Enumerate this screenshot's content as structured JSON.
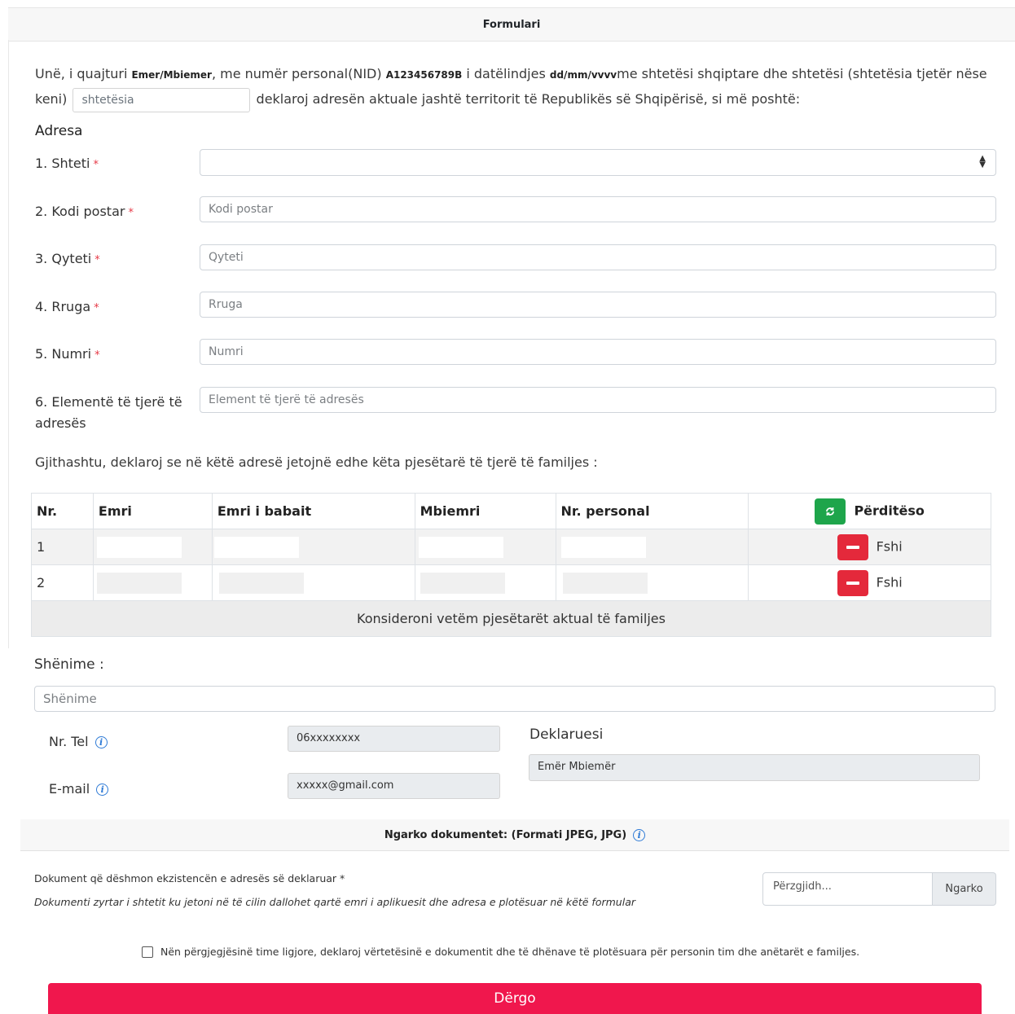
{
  "header": {
    "title": "Formulari"
  },
  "intro": {
    "p1": "Unë, i quajturi ",
    "name": "Emer/Mbiemer",
    "p2": ", me numër personal(NID) ",
    "nid": "A123456789B",
    "p3": " i datëlindjes ",
    "dob": "dd/mm/vvvv",
    "p4": "me shtetësi shqiptare dhe shtetësi (shtetësia tjetër nëse keni) ",
    "other_citizenship_placeholder": "shtetësia",
    "p5": " deklaroj adresën aktuale jashtë territorit të Republikës së Shqipërisë, si më poshtë:"
  },
  "address": {
    "title": "Adresa",
    "fields": [
      {
        "label": "1. Shteti",
        "required": "*",
        "placeholder": ""
      },
      {
        "label": "2. Kodi postar",
        "required": "*",
        "placeholder": "Kodi postar"
      },
      {
        "label": "3. Qyteti",
        "required": "*",
        "placeholder": "Qyteti"
      },
      {
        "label": "4. Rruga",
        "required": "*",
        "placeholder": "Rruga"
      },
      {
        "label": "5. Numri",
        "required": "*",
        "placeholder": "Numri"
      },
      {
        "label": "6. Elementë të tjerë të adresës",
        "required": "",
        "placeholder": "Element të tjerë të adresës"
      }
    ]
  },
  "family": {
    "intro": "Gjithashtu, deklaroj se në këtë adresë jetojnë edhe këta pjesëtarë të tjerë të familjes :",
    "columns": [
      "Nr.",
      "Emri",
      "Emri i babait",
      "Mbiemri",
      "Nr. personal"
    ],
    "update_label": "Përditëso",
    "rows": [
      {
        "nr": "1",
        "delete_label": "Fshi"
      },
      {
        "nr": "2",
        "delete_label": "Fshi"
      }
    ],
    "footer_note": "Konsideroni vetëm pjesëtarët aktual të familjes"
  },
  "notes": {
    "label": "Shënime :",
    "placeholder": "Shënime"
  },
  "contact": {
    "phone_label": "Nr. Tel",
    "phone_value": "06xxxxxxxx",
    "email_label": "E-mail",
    "email_value": "xxxxx@gmail.com",
    "declarant_label": "Deklaruesi",
    "declarant_value": "Emër Mbiemër"
  },
  "upload": {
    "title": "Ngarko dokumentet: (Formati JPEG, JPG)",
    "doc_label": "Dokument që dëshmon ekzistencën e adresës së deklaruar *",
    "doc_description": "Dokumenti zyrtar i shtetit ku jetoni në të cilin dallohet qartë emri i aplikuesit dhe adresa e plotësuar në këtë formular",
    "choose_label": "Përzgjidh...",
    "upload_button": "Ngarko"
  },
  "agreement": "Nën përgjegjësinë time ligjore, deklaroj vërtetësinë e dokumentit dhe të dhënave të plotësuara për personin tim dhe anëtarët e familjes.",
  "submit_label": "Dërgo",
  "colors": {
    "submit": "#f0174d",
    "update": "#1ea54b",
    "delete": "#e4293b",
    "info": "#2f7bd6"
  },
  "icons": [
    "sync-icon",
    "minus-icon",
    "info-icon",
    "sort-arrows-icon",
    "checkbox"
  ]
}
